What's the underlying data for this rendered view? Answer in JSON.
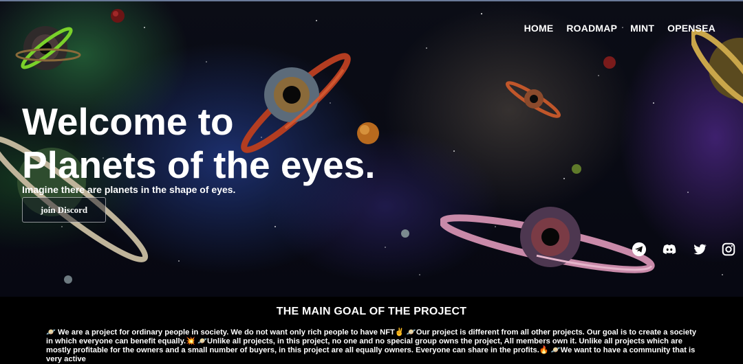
{
  "nav": {
    "items": [
      "HOME",
      "ROADMAP",
      "MINT",
      "OPENSEA"
    ]
  },
  "hero": {
    "title_line1": "Welcome to",
    "title_line2": "Planets of the eyes.",
    "tagline": "Imagine there are planets in the shape of eyes.",
    "cta_label": "join Discord"
  },
  "socials": [
    "telegram-icon",
    "discord-icon",
    "twitter-icon",
    "instagram-icon"
  ],
  "goal": {
    "heading": "THE MAIN GOAL OF THE PROJECT",
    "body": "🪐 We are a project for ordinary people in society. We do not want only rich people to have NFT✌️ 🪐Our project is different from all other projects. Our goal is to create a society in which everyone can benefit equally.💥 🪐Unlike all projects, in this project, no one and no special group owns the project, All members own it. Unlike all projects which are mostly profitable for the owners and a small number of buyers, in this project are all equally owners. Everyone can share in the profits.🔥 🪐We want to have a community that is very active"
  },
  "colors": {
    "accent_ring_orange": "#c9532a",
    "accent_ring_pink": "#d98bb0",
    "logo_ring_green": "#7ad12a",
    "bg": "#000000"
  }
}
